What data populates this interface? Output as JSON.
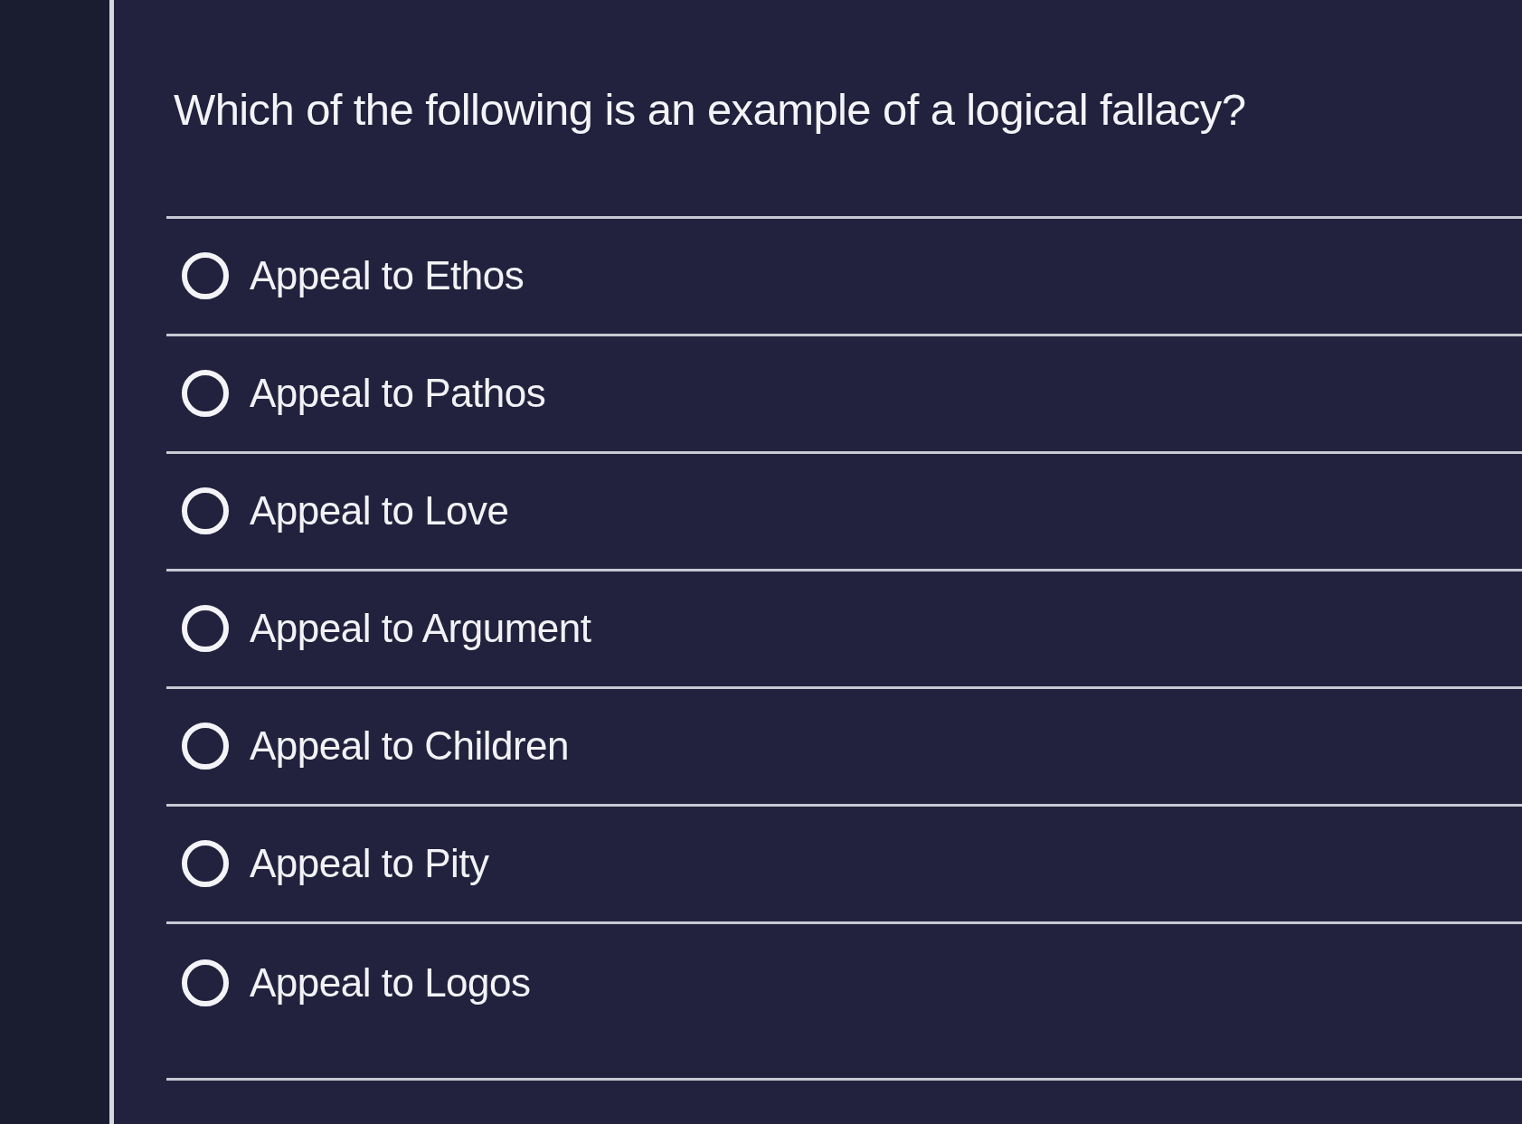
{
  "question": "Which of the following is an example of a logical fallacy?",
  "options": [
    {
      "label": "Appeal to Ethos",
      "selected": false
    },
    {
      "label": "Appeal to Pathos",
      "selected": false
    },
    {
      "label": "Appeal to Love",
      "selected": false
    },
    {
      "label": "Appeal to Argument",
      "selected": false
    },
    {
      "label": "Appeal to Children",
      "selected": false
    },
    {
      "label": "Appeal to Pity",
      "selected": false
    },
    {
      "label": "Appeal to Logos",
      "selected": false
    }
  ]
}
